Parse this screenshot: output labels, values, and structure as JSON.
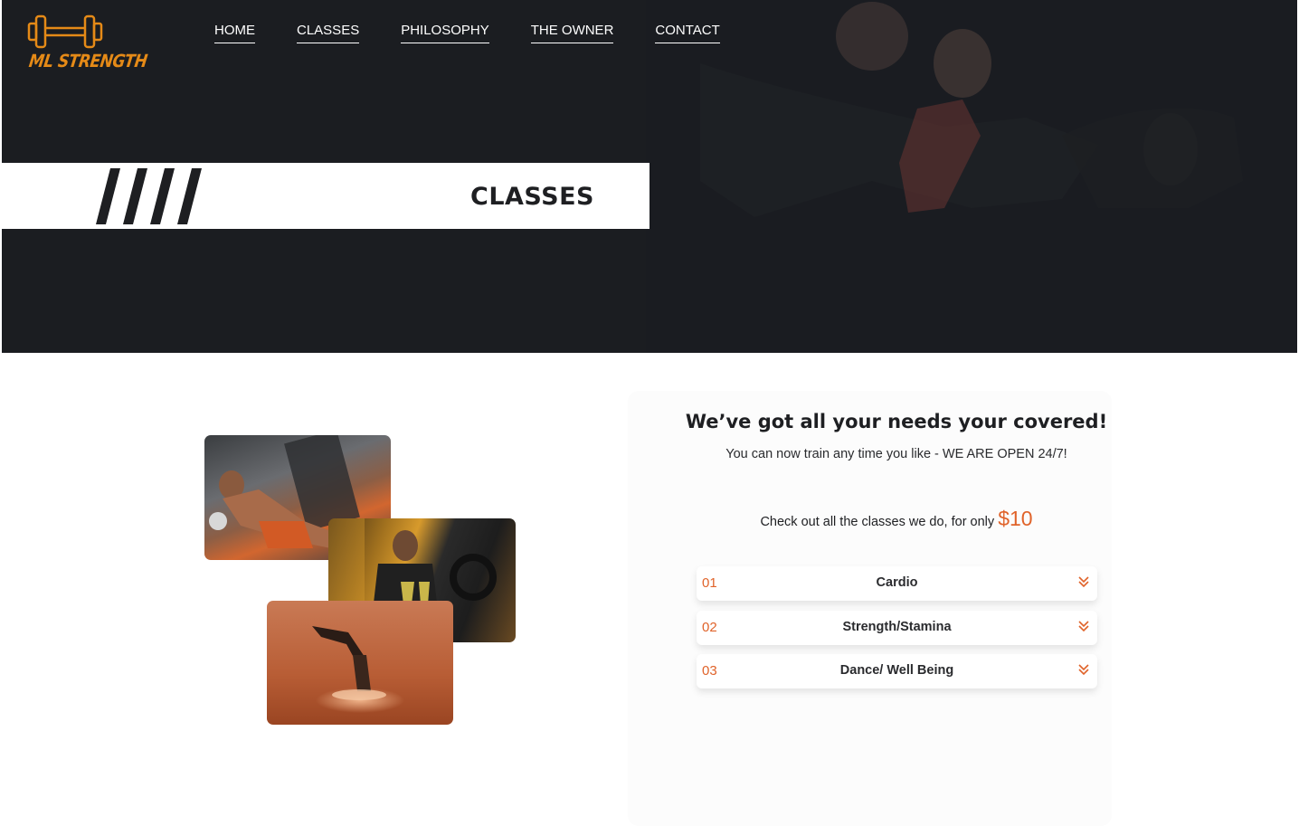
{
  "brand": {
    "name": "ML STRENGTH",
    "accent": "#e58a17",
    "price_color": "#e0632a"
  },
  "nav": {
    "items": [
      {
        "label": "HOME"
      },
      {
        "label": "CLASSES"
      },
      {
        "label": "PHILOSOPHY"
      },
      {
        "label": "THE OWNER"
      },
      {
        "label": "CONTACT"
      }
    ]
  },
  "hero": {
    "slashes": "////",
    "title": "CLASSES",
    "background": "#1b1d21"
  },
  "gallery": {
    "photos": [
      {
        "subject": "kickboxing-photo"
      },
      {
        "subject": "gym-weights-photo"
      },
      {
        "subject": "handstand-dance-photo"
      }
    ]
  },
  "card": {
    "title": "We’ve got all your needs your covered!",
    "subtitle": "You can now train any time you like - WE ARE OPEN 24/7!",
    "offer_text": "Check out all the classes we do, for only",
    "offer_price": "$10",
    "classes": [
      {
        "num": "01",
        "label": "Cardio",
        "icon": "chevron-double-down-icon"
      },
      {
        "num": "02",
        "label": "Strength/Stamina",
        "icon": "chevron-double-down-icon"
      },
      {
        "num": "03",
        "label": "Dance/ Well Being",
        "icon": "chevron-double-down-icon"
      }
    ]
  }
}
